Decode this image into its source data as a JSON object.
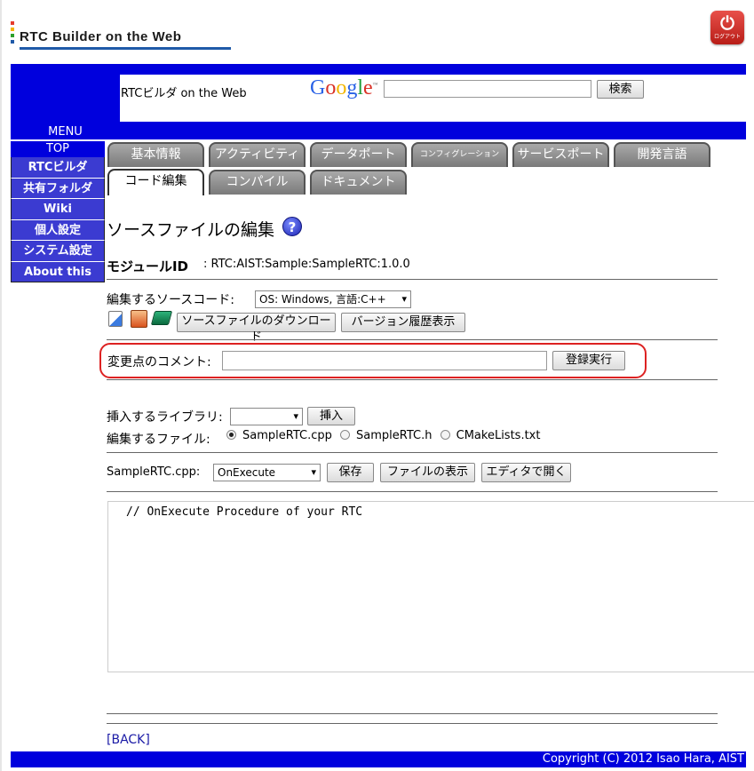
{
  "header": {
    "logo_text": "RTC Builder on the Web",
    "logout_label": "ログアウト"
  },
  "banner": {
    "site_name": "RTCビルダ on the Web",
    "google_logo": "Google",
    "search_placeholder": "",
    "search_button": "検索"
  },
  "menu": {
    "title": "MENU",
    "top": "TOP",
    "items": [
      "RTCビルダ",
      "共有フォルダ",
      "Wiki",
      "個人設定",
      "システム設定",
      "About this"
    ]
  },
  "tabs": {
    "row1": [
      "基本情報",
      "アクティビティ",
      "データポート",
      "コンフィグレーション",
      "サービスポート",
      "開発言語"
    ],
    "row2": [
      "コード編集",
      "コンパイル",
      "ドキュメント"
    ],
    "active": "コード編集"
  },
  "main": {
    "title": "ソースファイルの編集",
    "help_icon": "?",
    "module_label": "モジュールID",
    "module_value": ": RTC:AIST:Sample:SampleRTC:1.0.0",
    "source_label": "編集するソースコード:",
    "source_select": "OS: Windows, 言語:C++",
    "download_button": "ソースファイルのダウンロード",
    "history_button": "バージョン履歴表示",
    "comment_label": "変更点のコメント:",
    "comment_value": "",
    "register_button": "登録実行",
    "library_label": "挿入するライブラリ:",
    "library_select": "",
    "insert_button": "挿入",
    "file_label": "編集するファイル:",
    "files": [
      "SampleRTC.cpp",
      "SampleRTC.h",
      "CMakeLists.txt"
    ],
    "selected_file": "SampleRTC.cpp",
    "function_file_label": "SampleRTC.cpp:",
    "function_select": "OnExecute",
    "save_button": "保存",
    "show_file_button": "ファイルの表示",
    "open_editor_button": "エディタで開く",
    "editor_content": "// OnExecute Procedure of your RTC",
    "back_link": "[BACK]"
  },
  "footer": {
    "copyright": "Copyright (C) 2012 Isao Hara, AIST"
  },
  "colors": {
    "banner_blue": "#0000dd",
    "menu_item_blue": "#3b3bd1",
    "highlight_red": "#dd2222",
    "tab_gray": "#8a8a8a"
  }
}
